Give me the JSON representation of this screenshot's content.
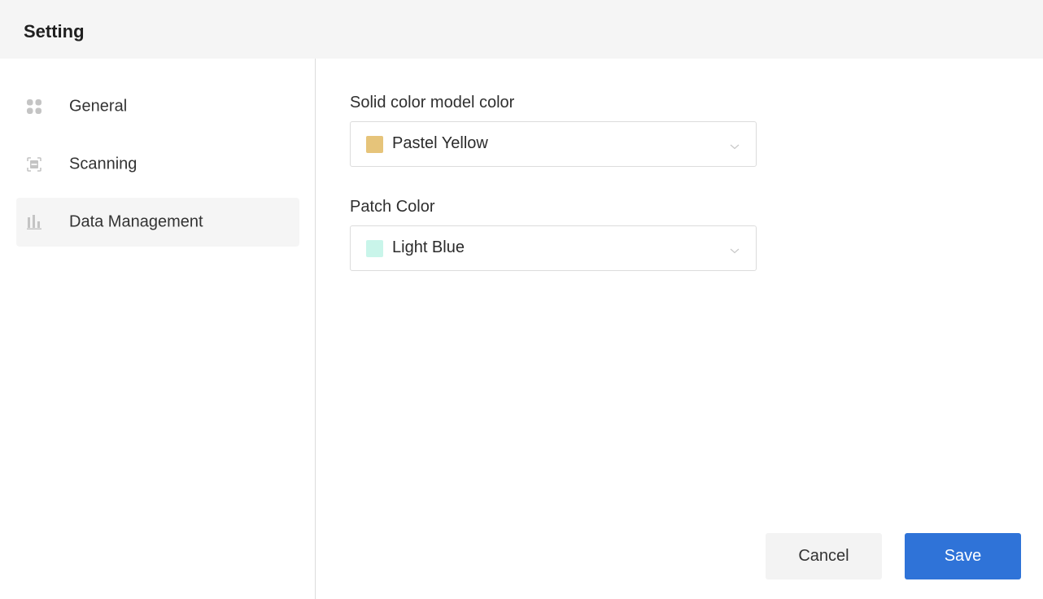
{
  "header": {
    "title": "Setting"
  },
  "sidebar": {
    "items": [
      {
        "label": "General",
        "icon": "grid-icon",
        "active": false
      },
      {
        "label": "Scanning",
        "icon": "scan-icon",
        "active": false
      },
      {
        "label": "Data Management",
        "icon": "bar-chart-icon",
        "active": true
      }
    ]
  },
  "form": {
    "solid_color": {
      "label": "Solid color model color",
      "value": "Pastel Yellow",
      "swatch": "#e6c47a"
    },
    "patch_color": {
      "label": "Patch Color",
      "value": "Light Blue",
      "swatch": "#c9f5ea"
    }
  },
  "actions": {
    "cancel_label": "Cancel",
    "save_label": "Save"
  },
  "colors": {
    "accent": "#2f73d8",
    "header_bg": "#f5f5f5",
    "icon": "#c4c4c4"
  }
}
